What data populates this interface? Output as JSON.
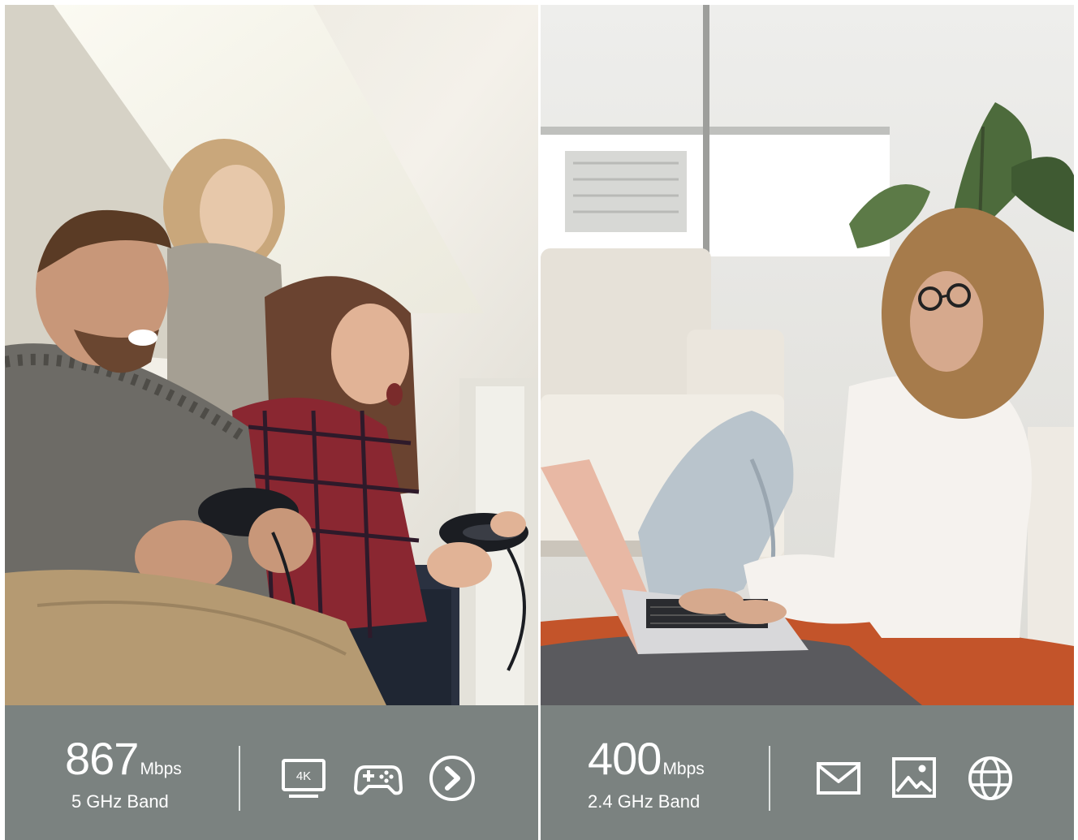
{
  "panels": [
    {
      "speed_value": "867",
      "speed_unit": "Mbps",
      "band": "5 GHz Band",
      "icons": [
        "4k-tv-icon",
        "gamepad-icon",
        "play-circle-icon"
      ],
      "icon_texts": {
        "tv_label": "4K"
      }
    },
    {
      "speed_value": "400",
      "speed_unit": "Mbps",
      "band": "2.4 GHz Band",
      "icons": [
        "email-icon",
        "image-icon",
        "globe-icon"
      ]
    }
  ],
  "colors": {
    "bar_background": "#7b8280",
    "text": "#ffffff",
    "divider": "#dfe3e2"
  }
}
